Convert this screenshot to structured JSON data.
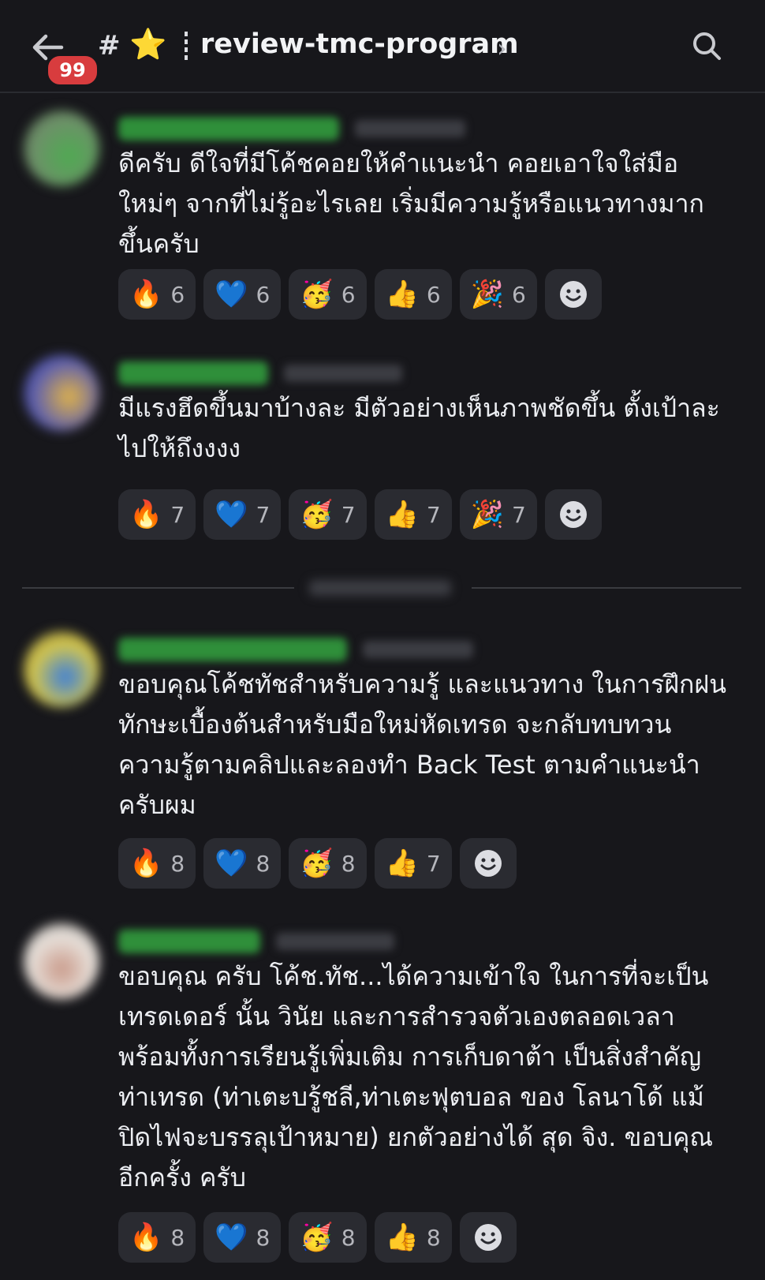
{
  "header": {
    "unread_count": "99",
    "channel_prefix": "#",
    "channel_emoji": "⭐",
    "channel_name": "review-tmc-program",
    "chevron": "›"
  },
  "messages": [
    {
      "text": "ดีครับ ดีใจที่มีโค้ชคอยให้คำแนะนำ คอยเอาใจใส่มือ\nใหม่ๆ จากที่ไม่รู้อะไรเลย เริ่มมีความรู้หรือแนวทางมาก\nขึ้นครับ",
      "reactions": [
        {
          "emoji": "🔥",
          "count": "6"
        },
        {
          "emoji": "💙",
          "count": "6"
        },
        {
          "emoji": "🥳",
          "count": "6"
        },
        {
          "emoji": "👍",
          "count": "6"
        },
        {
          "emoji": "🎉",
          "count": "6"
        }
      ]
    },
    {
      "text": "มีแรงฮึดขึ้นมาบ้างละ มีตัวอย่างเห็นภาพชัดขึ้น ตั้งเป้าละ\nไปให้ถึงงงง",
      "reactions": [
        {
          "emoji": "🔥",
          "count": "7"
        },
        {
          "emoji": "💙",
          "count": "7"
        },
        {
          "emoji": "🥳",
          "count": "7"
        },
        {
          "emoji": "👍",
          "count": "7"
        },
        {
          "emoji": "🎉",
          "count": "7"
        }
      ]
    },
    {
      "text": "ขอบคุณโค้ชทัชสำหรับความรู้ และแนวทาง ในการฝึกฝน\nทักษะเบื้องต้นสำหรับมือใหม่หัดเทรด จะกลับทบทวน\nความรู้ตามคลิปและลองทำ Back Test ตามคำแนะนำ\nครับผม",
      "reactions": [
        {
          "emoji": "🔥",
          "count": "8"
        },
        {
          "emoji": "💙",
          "count": "8"
        },
        {
          "emoji": "🥳",
          "count": "8"
        },
        {
          "emoji": "👍",
          "count": "7"
        }
      ]
    },
    {
      "text": "ขอบคุณ ครับ โค้ช.ทัช...ได้ความเข้าใจ ในการที่จะเป็น\nเทรดเดอร์ นั้น วินัย และการสำรวจตัวเองตลอดเวลา\nพร้อมทั้งการเรียนรู้เพิ่มเติม การเก็บดาต้า เป็นสิ่งสำคัญ\nท่าเทรด (ท่าเตะบรู้ชลี,ท่าเตะฟุตบอล ของ โลนาโด้ แม้\nปิดไฟจะบรรลุเป้าหมาย) ยกตัวอย่างได้ สุด จิง. ขอบคุณ\nอีกครั้ง ครับ",
      "reactions": [
        {
          "emoji": "🔥",
          "count": "8"
        },
        {
          "emoji": "💙",
          "count": "8"
        },
        {
          "emoji": "🥳",
          "count": "8"
        },
        {
          "emoji": "👍",
          "count": "8"
        }
      ]
    }
  ],
  "colors": {
    "background": "#17171b",
    "pill": "#2a2b31",
    "badge": "#d83c3e",
    "username_green": "#2f8f3a"
  },
  "icons": [
    "back-arrow-icon",
    "text-channel-icon",
    "star-icon",
    "chevron-right-icon",
    "search-icon",
    "add-reaction-icon"
  ]
}
